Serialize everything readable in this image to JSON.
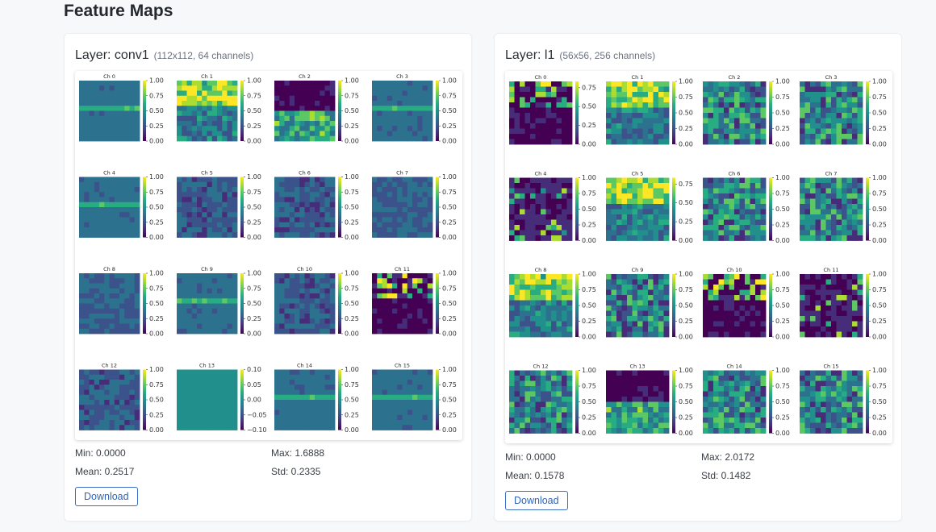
{
  "page": {
    "title": "Feature Maps"
  },
  "panels": [
    {
      "layer_label": "Layer: conv1",
      "layer_meta": "(112x112, 64 channels)",
      "stats": {
        "min": "Min: 0.0000",
        "max": "Max: 1.6888",
        "mean": "Mean: 0.2517",
        "std": "Std: 0.2335"
      },
      "download_label": "Download",
      "channels": [
        {
          "title": "Ch 0",
          "ticks": [
            "1.00",
            "0.75",
            "0.50",
            "0.25",
            "0.00"
          ],
          "style": "edges"
        },
        {
          "title": "Ch 1",
          "ticks": [
            "1.00",
            "0.75",
            "0.50",
            "0.25",
            "0.00"
          ],
          "style": "bright"
        },
        {
          "title": "Ch 2",
          "ticks": [
            "1.00",
            "0.75",
            "0.50",
            "0.25",
            "0.00"
          ],
          "style": "darktop"
        },
        {
          "title": "Ch 3",
          "ticks": [
            "1.00",
            "0.75",
            "0.50",
            "0.25",
            "0.00"
          ],
          "style": "edges"
        },
        {
          "title": "Ch 4",
          "ticks": [
            "1.00",
            "0.75",
            "0.50",
            "0.25",
            "0.00"
          ],
          "style": "edges"
        },
        {
          "title": "Ch 5",
          "ticks": [
            "1.00",
            "0.75",
            "0.50",
            "0.25",
            "0.00"
          ],
          "style": "texture"
        },
        {
          "title": "Ch 6",
          "ticks": [
            "1.00",
            "0.75",
            "0.50",
            "0.25",
            "0.00"
          ],
          "style": "texture"
        },
        {
          "title": "Ch 7",
          "ticks": [
            "1.00",
            "0.75",
            "0.50",
            "0.25",
            "0.00"
          ],
          "style": "flat"
        },
        {
          "title": "Ch 8",
          "ticks": [
            "1.00",
            "0.75",
            "0.50",
            "0.25",
            "0.00"
          ],
          "style": "flat"
        },
        {
          "title": "Ch 9",
          "ticks": [
            "1.00",
            "0.75",
            "0.50",
            "0.25",
            "0.00"
          ],
          "style": "edges"
        },
        {
          "title": "Ch 10",
          "ticks": [
            "1.00",
            "0.75",
            "0.50",
            "0.25",
            "0.00"
          ],
          "style": "texture"
        },
        {
          "title": "Ch 11",
          "ticks": [
            "1.00",
            "0.75",
            "0.50",
            "0.25",
            "0.00"
          ],
          "style": "darkblob"
        },
        {
          "title": "Ch 12",
          "ticks": [
            "1.00",
            "0.75",
            "0.50",
            "0.25",
            "0.00"
          ],
          "style": "texture"
        },
        {
          "title": "Ch 13",
          "ticks": [
            "0.10",
            "0.05",
            "0.00",
            "−0.05",
            "−0.10"
          ],
          "style": "solid"
        },
        {
          "title": "Ch 14",
          "ticks": [
            "1.00",
            "0.75",
            "0.50",
            "0.25",
            "0.00"
          ],
          "style": "edges"
        },
        {
          "title": "Ch 15",
          "ticks": [
            "1.00",
            "0.75",
            "0.50",
            "0.25",
            "0.00"
          ],
          "style": "edges"
        }
      ]
    },
    {
      "layer_label": "Layer: l1",
      "layer_meta": "(56x56, 256 channels)",
      "stats": {
        "min": "Min: 0.0000",
        "max": "Max: 2.0172",
        "mean": "Mean: 0.1578",
        "std": "Std: 0.1482"
      },
      "download_label": "Download",
      "channels": [
        {
          "title": "Ch 0",
          "ticks": [
            "0.75",
            "0.50",
            "0.25",
            "0.00"
          ],
          "style": "darkblob"
        },
        {
          "title": "Ch 1",
          "ticks": [
            "1.00",
            "0.75",
            "0.50",
            "0.25",
            "0.00"
          ],
          "style": "bright"
        },
        {
          "title": "Ch 2",
          "ticks": [
            "1.00",
            "0.75",
            "0.50",
            "0.25",
            "0.00"
          ],
          "style": "noisy"
        },
        {
          "title": "Ch 3",
          "ticks": [
            "1.00",
            "0.75",
            "0.50",
            "0.25",
            "0.00"
          ],
          "style": "noisy"
        },
        {
          "title": "Ch 4",
          "ticks": [
            "1.00",
            "0.75",
            "0.50",
            "0.25",
            "0.00"
          ],
          "style": "speckle"
        },
        {
          "title": "Ch 5",
          "ticks": [
            "0.75",
            "0.50",
            "0.25",
            "0.00"
          ],
          "style": "bright"
        },
        {
          "title": "Ch 6",
          "ticks": [
            "1.00",
            "0.75",
            "0.50",
            "0.25",
            "0.00"
          ],
          "style": "noisy"
        },
        {
          "title": "Ch 7",
          "ticks": [
            "1.00",
            "0.75",
            "0.50",
            "0.25",
            "0.00"
          ],
          "style": "noisy"
        },
        {
          "title": "Ch 8",
          "ticks": [
            "1.00",
            "0.75",
            "0.50",
            "0.25",
            "0.00"
          ],
          "style": "bright"
        },
        {
          "title": "Ch 9",
          "ticks": [
            "1.00",
            "0.75",
            "0.50",
            "0.25",
            "0.00"
          ],
          "style": "noisy"
        },
        {
          "title": "Ch 10",
          "ticks": [
            "1.00",
            "0.75",
            "0.50",
            "0.25",
            "0.00"
          ],
          "style": "darkblob"
        },
        {
          "title": "Ch 11",
          "ticks": [
            "1.00",
            "0.75",
            "0.50",
            "0.25",
            "0.00"
          ],
          "style": "speckle"
        },
        {
          "title": "Ch 12",
          "ticks": [
            "1.00",
            "0.75",
            "0.50",
            "0.25",
            "0.00"
          ],
          "style": "noisy"
        },
        {
          "title": "Ch 13",
          "ticks": [
            "1.00",
            "0.75",
            "0.50",
            "0.25",
            "0.00"
          ],
          "style": "darktop"
        },
        {
          "title": "Ch 14",
          "ticks": [
            "1.00",
            "0.75",
            "0.50",
            "0.25",
            "0.00"
          ],
          "style": "noisy"
        },
        {
          "title": "Ch 15",
          "ticks": [
            "1.00",
            "0.75",
            "0.50",
            "0.25",
            "0.00"
          ],
          "style": "noisy"
        }
      ]
    }
  ],
  "colors": {
    "viridis": [
      "#440154",
      "#472c7a",
      "#3b528b",
      "#2c728e",
      "#21908d",
      "#27ad81",
      "#5cc863",
      "#aadc32",
      "#fde725"
    ]
  }
}
